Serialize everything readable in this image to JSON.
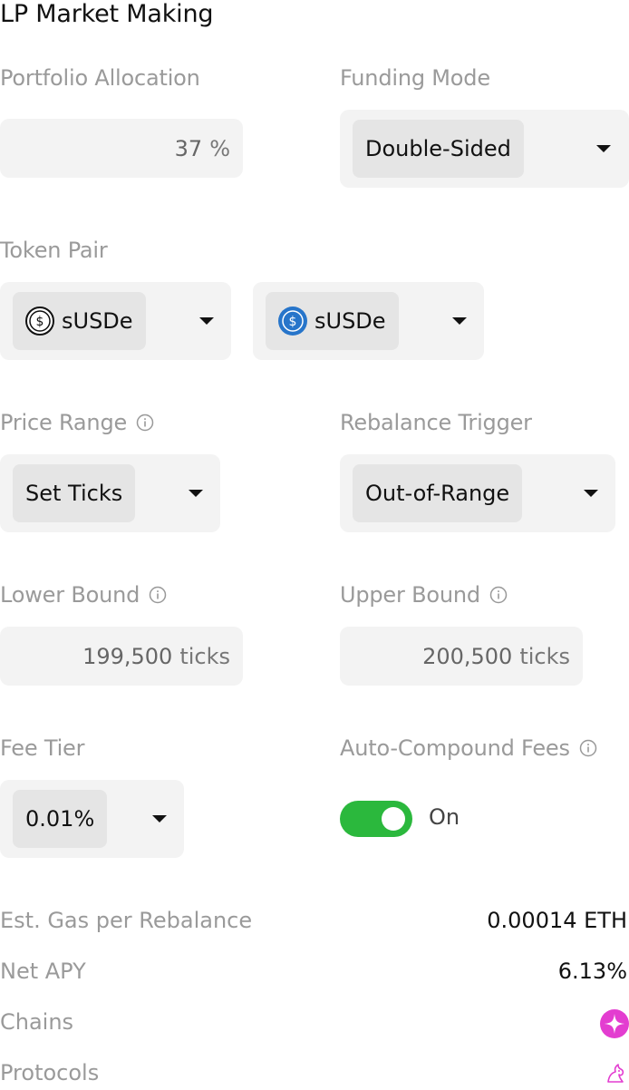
{
  "page": {
    "title": "LP Market Making"
  },
  "portfolio_allocation": {
    "label": "Portfolio Allocation",
    "value": "37",
    "unit": "%"
  },
  "funding_mode": {
    "label": "Funding Mode",
    "selected": "Double-Sided"
  },
  "token_pair": {
    "label": "Token Pair",
    "token_a": {
      "symbol": "sUSDe",
      "icon": "susde-icon"
    },
    "token_b": {
      "symbol": "sUSDe",
      "icon": "usdc-style-icon"
    }
  },
  "price_range": {
    "label": "Price Range",
    "selected": "Set Ticks"
  },
  "rebalance_trigger": {
    "label": "Rebalance Trigger",
    "selected": "Out-of-Range"
  },
  "lower_bound": {
    "label": "Lower Bound",
    "value": "199,500",
    "unit": "ticks"
  },
  "upper_bound": {
    "label": "Upper Bound",
    "value": "200,500",
    "unit": "ticks"
  },
  "fee_tier": {
    "label": "Fee Tier",
    "selected": "0.01%"
  },
  "auto_compound": {
    "label": "Auto-Compound Fees",
    "state_text": "On",
    "enabled": true
  },
  "summary": {
    "gas_label": "Est. Gas per Rebalance",
    "gas_value": "0.00014 ETH",
    "apy_label": "Net APY",
    "apy_value": "6.13%",
    "chains_label": "Chains",
    "chains_icon": "chain-star-icon",
    "protocols_label": "Protocols",
    "protocols_icon": "unicorn-icon"
  },
  "colors": {
    "toggle_on": "#2bb83d",
    "chain_icon": "#e33dd0",
    "usdc_blue": "#2775ca"
  }
}
